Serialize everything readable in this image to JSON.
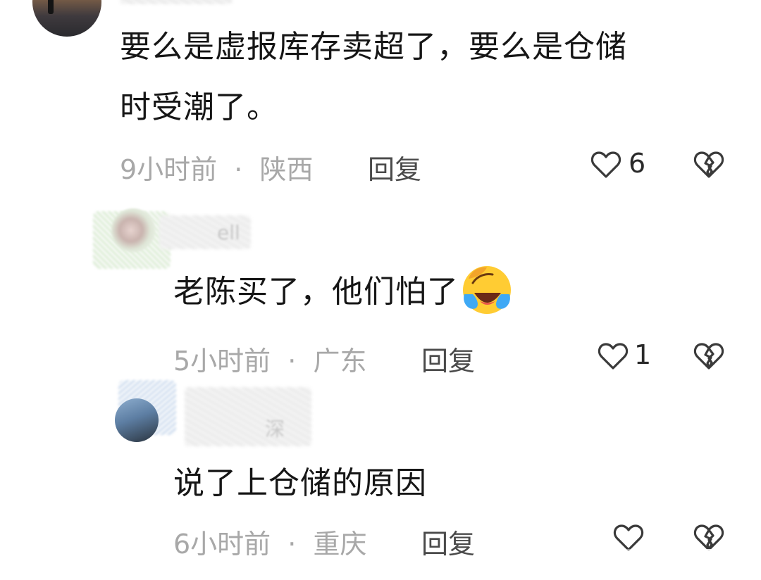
{
  "comments": [
    {
      "username": "",
      "text_line1": "要么是虚报库存卖超了，要么是仓储",
      "text_line2": "时受潮了。",
      "time": "9小时前",
      "location": "陕西",
      "separator": "·",
      "reply_label": "回复",
      "likes": "6"
    },
    {
      "username": "ell",
      "text": "老陈买了，他们怕了",
      "emoji": "crying-laughing-face",
      "time": "5小时前",
      "location": "广东",
      "separator": "·",
      "reply_label": "回复",
      "likes": "1"
    },
    {
      "username": "深",
      "text": "说了上仓储的原因",
      "time": "6小时前",
      "location": "重庆",
      "separator": "·",
      "reply_label": "回复",
      "likes": ""
    }
  ],
  "colors": {
    "text": "#161616",
    "meta": "#a8a8a8",
    "reply": "#4a4a4a",
    "emoji_face": "#ffcc33",
    "emoji_tear": "#3fa9f5"
  }
}
